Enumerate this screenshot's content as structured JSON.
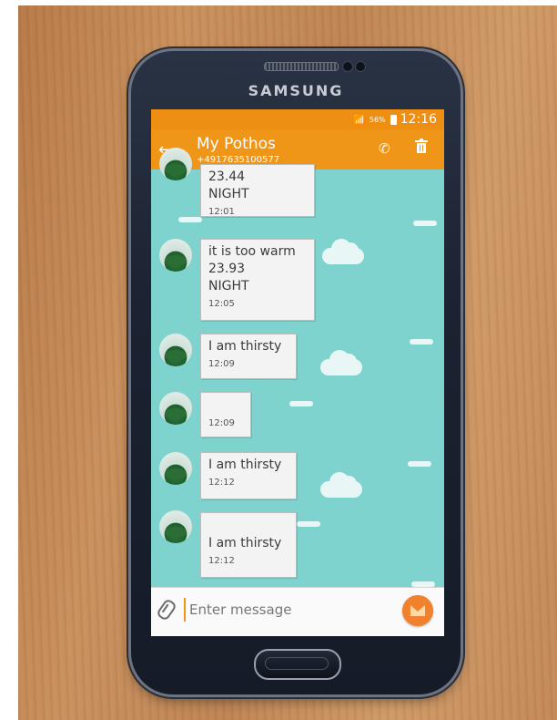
{
  "device": {
    "brand": "SAMSUNG"
  },
  "status_bar": {
    "battery": "56%",
    "time": "12:16"
  },
  "header": {
    "back_icon": "arrow-left-icon",
    "contact_name": "My Pothos",
    "phone_number": "+4917635100577",
    "call_icon": "phone-icon",
    "delete_icon": "trash-icon"
  },
  "messages": [
    {
      "text": "23.44\nNIGHT",
      "time": "12:01"
    },
    {
      "text": "it is too warm\n23.93\nNIGHT",
      "time": "12:05"
    },
    {
      "text": "I am thirsty",
      "time": "12:09"
    },
    {
      "text": "",
      "time": "12:09"
    },
    {
      "text": "I am thirsty",
      "time": "12:12"
    },
    {
      "text": "I am thirsty",
      "time": "12:12"
    }
  ],
  "composer": {
    "attach_icon": "paperclip-icon",
    "placeholder": "Enter message",
    "send_icon": "envelope-icon"
  },
  "colors": {
    "accent": "#ef9618",
    "chat_background": "#7fd3cf",
    "send_button": "#f1812c"
  }
}
